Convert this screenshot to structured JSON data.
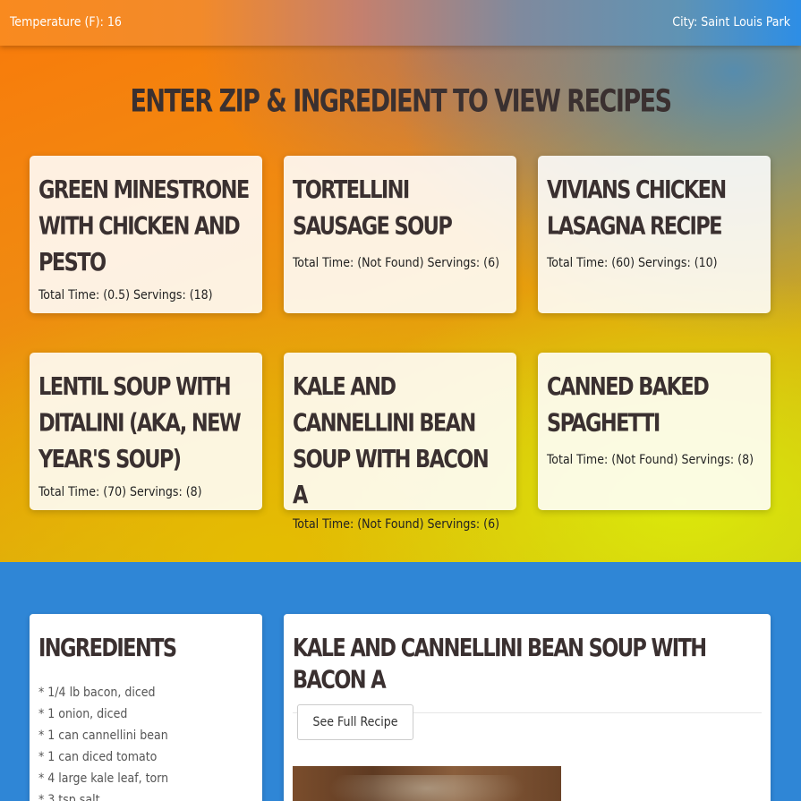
{
  "topbar": {
    "temperature": "Temperature (F): 16",
    "city": "City: Saint Louis Park"
  },
  "heading": "Enter Zip & Ingredient to view recipes",
  "cards": [
    {
      "title": "Green Minestrone with Chicken and Pesto",
      "meta": "Total Time: (0.5) Servings: (18)"
    },
    {
      "title": "Tortellini Sausage Soup",
      "meta": "Total Time: (Not Found) Servings: (6)"
    },
    {
      "title": "Vivians Chicken Lasagna Recipe",
      "meta": "Total Time: (60) Servings: (10)"
    },
    {
      "title": "Lentil Soup with Ditalini (aka, New Year's Soup)",
      "meta": "Total Time: (70) Servings: (8)"
    },
    {
      "title": "Kale and Cannellini Bean Soup with Bacon A",
      "meta": "Total Time: (Not Found) Servings: (6)"
    },
    {
      "title": "Canned Baked Spaghetti",
      "meta": "Total Time: (Not Found) Servings: (8)"
    }
  ],
  "ingredients": {
    "title": "Ingredients",
    "items": [
      "* 1/4 lb bacon, diced",
      "* 1 onion, diced",
      "* 1 can cannellini bean",
      "* 1 can diced tomato",
      "* 4 large kale leaf, torn",
      "* 3 tsp salt"
    ]
  },
  "recipe": {
    "title": "Kale and Cannellini Bean Soup with Bacon A",
    "button_label": "See Full Recipe"
  }
}
